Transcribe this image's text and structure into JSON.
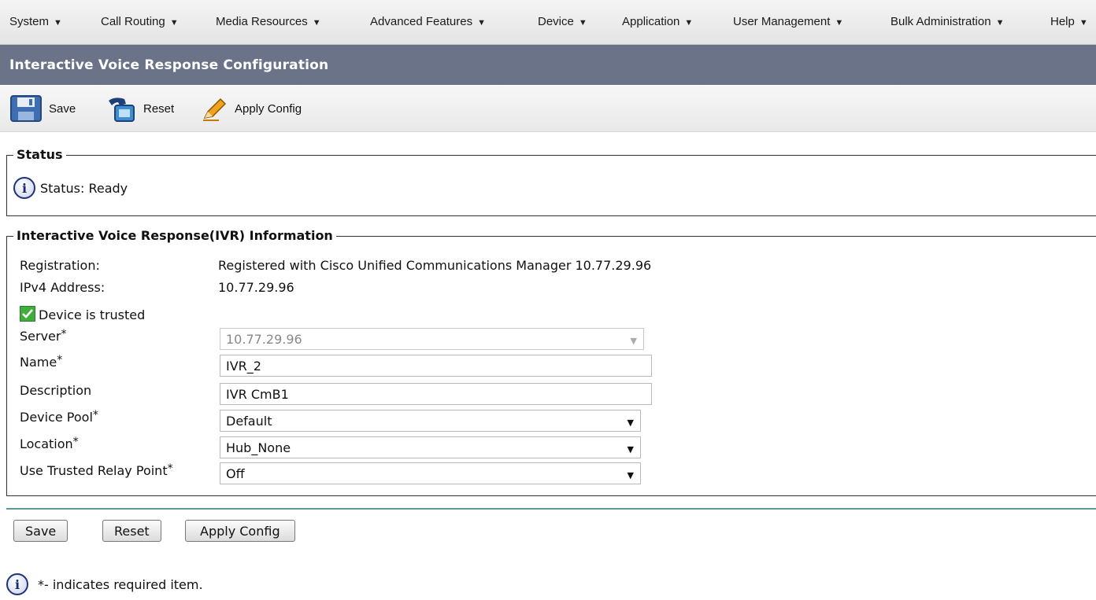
{
  "menu": {
    "items": [
      {
        "label": "System"
      },
      {
        "label": "Call Routing"
      },
      {
        "label": "Media Resources"
      },
      {
        "label": "Advanced Features"
      },
      {
        "label": "Device"
      },
      {
        "label": "Application"
      },
      {
        "label": "User Management"
      },
      {
        "label": "Bulk Administration"
      },
      {
        "label": "Help"
      }
    ],
    "caret_icon": "caret-down-icon"
  },
  "page": {
    "title": "Interactive Voice Response Configuration"
  },
  "toolbar": {
    "save_label": "Save",
    "reset_label": "Reset",
    "apply_label": "Apply Config",
    "save_icon": "floppy-disk-icon",
    "reset_icon": "reset-phone-icon",
    "apply_icon": "pencil-icon"
  },
  "status_section": {
    "legend": "Status",
    "text": "Status: Ready",
    "icon": "info-icon"
  },
  "ivr_section": {
    "legend": "Interactive Voice Response(IVR) Information",
    "registration_label": "Registration:",
    "registration_value": "Registered with Cisco Unified Communications Manager 10.77.29.96",
    "ipv4_label": "IPv4 Address:",
    "ipv4_value": "10.77.29.96",
    "trusted_label": "Device is trusted",
    "trusted_checked": true,
    "server_label": "Server",
    "server_value": "10.77.29.96",
    "name_label": "Name",
    "name_value": "IVR_2",
    "description_label": "Description",
    "description_value": "IVR CmB1",
    "device_pool_label": "Device Pool",
    "device_pool_value": "Default",
    "location_label": "Location",
    "location_value": "Hub_None",
    "relay_label": "Use Trusted Relay Point",
    "relay_value": "Off",
    "required_marker": "*"
  },
  "buttons": {
    "save": "Save",
    "reset": "Reset",
    "apply": "Apply Config"
  },
  "footer": {
    "note": "*- indicates required item."
  },
  "colors": {
    "title_bar": "#6b7388",
    "separator": "#5a9a9a",
    "info_icon_border": "#223277",
    "checkbox_green": "#3fae3f"
  }
}
